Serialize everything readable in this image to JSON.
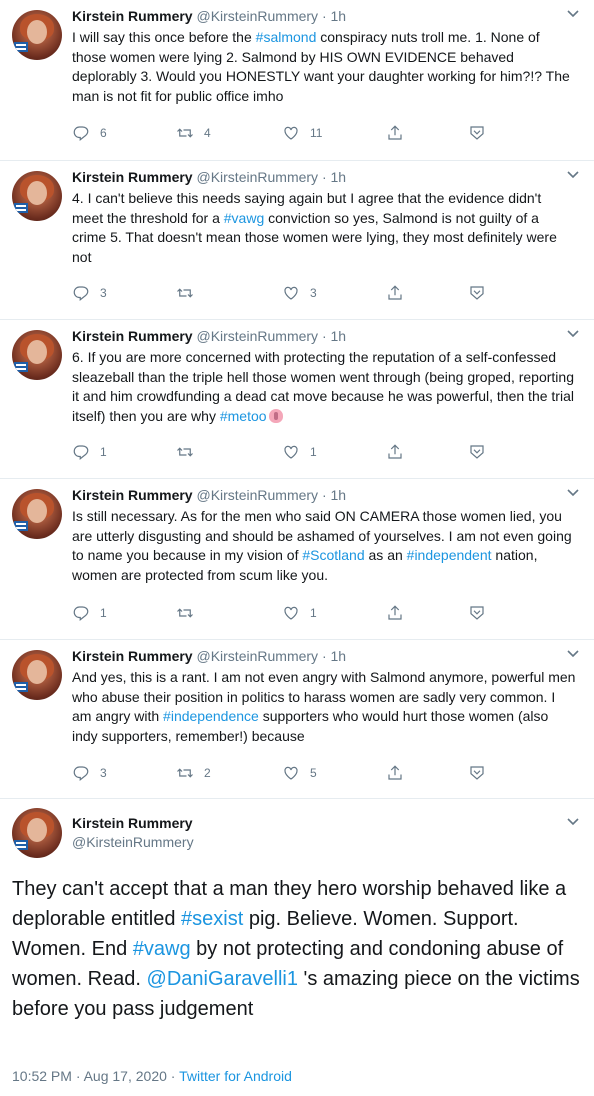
{
  "tweets": [
    {
      "name": "Kirstein Rummery",
      "handle": "@KirsteinRummery",
      "time": "1h",
      "body": [
        {
          "t": "I will say this once before the "
        },
        {
          "t": "#salmond",
          "tag": true
        },
        {
          "t": " conspiracy nuts troll me. 1. None of those women were lying 2. Salmond by HIS OWN EVIDENCE behaved deplorably 3. Would you HONESTLY want your daughter working for him?!? The man is not fit for public office imho"
        }
      ],
      "replies": "6",
      "retweets": "4",
      "likes": "11"
    },
    {
      "name": "Kirstein Rummery",
      "handle": "@KirsteinRummery",
      "time": "1h",
      "body": [
        {
          "t": "4. I can't believe this needs saying again but I agree that the evidence didn't meet the threshold for a "
        },
        {
          "t": "#vawg",
          "tag": true
        },
        {
          "t": " conviction so yes, Salmond is not guilty of a crime 5. That doesn't mean those women were lying, they most definitely were not"
        }
      ],
      "replies": "3",
      "retweets": "",
      "likes": "3"
    },
    {
      "name": "Kirstein Rummery",
      "handle": "@KirsteinRummery",
      "time": "1h",
      "body": [
        {
          "t": "6. If you are more concerned with protecting the reputation of a self-confessed sleazeball than the triple hell those women went through (being groped, reporting it and him crowdfunding a dead cat move because he was powerful, then the trial itself) then you are why "
        },
        {
          "t": "#metoo",
          "tag": true
        }
      ],
      "emoji": "raised-fist-emoji",
      "replies": "1",
      "retweets": "",
      "likes": "1"
    },
    {
      "name": "Kirstein Rummery",
      "handle": "@KirsteinRummery",
      "time": "1h",
      "body": [
        {
          "t": "Is still necessary.  As for the men who said ON CAMERA those women lied, you are utterly disgusting and should be ashamed of yourselves. I am not even going to name you because in my vision of "
        },
        {
          "t": "#Scotland",
          "tag": true
        },
        {
          "t": " as an "
        },
        {
          "t": "#independent",
          "tag": true
        },
        {
          "t": " nation, women are protected from scum like you."
        }
      ],
      "replies": "1",
      "retweets": "",
      "likes": "1"
    },
    {
      "name": "Kirstein Rummery",
      "handle": "@KirsteinRummery",
      "time": "1h",
      "body": [
        {
          "t": "And yes, this is a rant. I am not even angry with Salmond anymore, powerful men who abuse their position in politics to harass women are sadly very common. I am angry with "
        },
        {
          "t": "#independence",
          "tag": true
        },
        {
          "t": " supporters who would hurt those women (also indy supporters, remember!) because"
        }
      ],
      "replies": "3",
      "retweets": "2",
      "likes": "5"
    }
  ],
  "main": {
    "name": "Kirstein Rummery",
    "handle": "@KirsteinRummery",
    "body": [
      {
        "t": "They can't accept that a man they hero worship behaved like a deplorable entitled "
      },
      {
        "t": "#sexist",
        "tag": true
      },
      {
        "t": " pig. Believe. Women. Support. Women. End "
      },
      {
        "t": "#vawg",
        "tag": true
      },
      {
        "t": " by not protecting and condoning abuse of women. Read. "
      },
      {
        "t": "@DaniGaravelli1",
        "tag": true
      },
      {
        "t": " 's amazing piece on the victims before you pass judgement"
      }
    ],
    "timestamp": "10:52 PM · Aug 17, 2020 · ",
    "source": "Twitter for Android"
  },
  "colors": {
    "link": "#1b95e0",
    "muted": "#657786",
    "text": "#14171a",
    "divider": "#e6ecf0"
  },
  "icons": [
    "reply-icon",
    "retweet-icon",
    "like-icon",
    "share-icon",
    "bookmark-icon",
    "chevron-down-icon"
  ]
}
